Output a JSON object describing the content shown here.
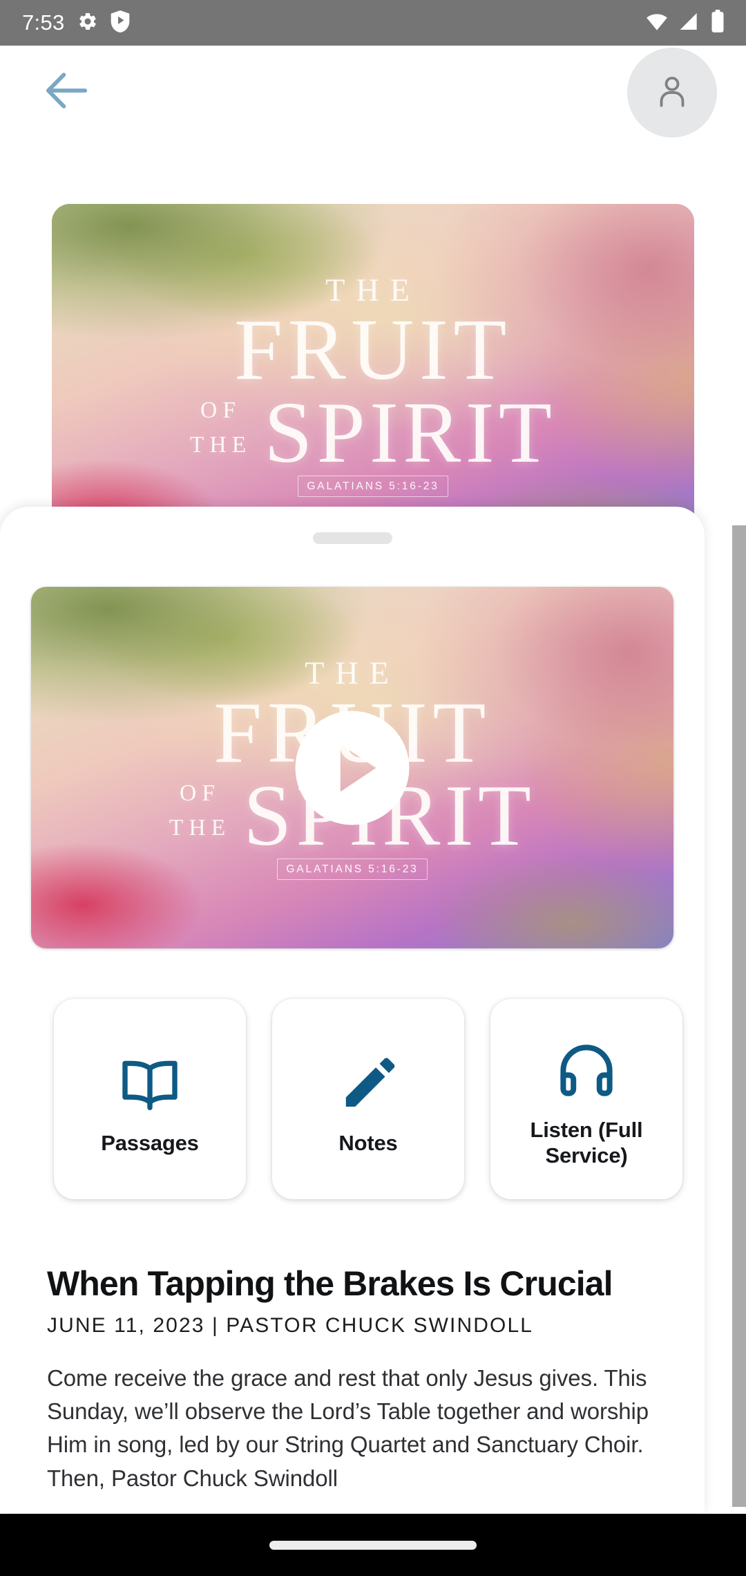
{
  "status_bar": {
    "time": "7:53",
    "left_icons": [
      "gear-icon",
      "play-protect-shield-icon"
    ],
    "right_icons": [
      "wifi-icon",
      "cellular-signal-icon",
      "battery-icon"
    ],
    "background_color": "#757575"
  },
  "app_bar": {
    "back_icon": "back-arrow-icon",
    "back_color": "#7ba7c4",
    "avatar_icon": "person-icon",
    "avatar_bg": "#e6e7e8"
  },
  "artwork": {
    "line_the": "THE",
    "line_fruit": "FRUIT",
    "line_of": "OF",
    "line_the2": "THE",
    "line_spirit": "SPIRIT",
    "reference": "GALATIANS 5:16-23"
  },
  "sheet": {
    "handle": "drag-handle",
    "video": {
      "play_icon": "play-icon",
      "label": "Sermon video thumbnail"
    },
    "actions": [
      {
        "label": "Passages",
        "icon": "open-book-icon"
      },
      {
        "label": "Notes",
        "icon": "pencil-icon"
      },
      {
        "label": "Listen (Full Service)",
        "icon": "headphones-icon"
      }
    ],
    "accent_color": "#0e5a85",
    "sermon": {
      "title": "When Tapping the Brakes Is Crucial",
      "byline": "JUNE 11, 2023 | PASTOR CHUCK SWINDOLL",
      "body": "Come receive the grace and rest that only Jesus gives. This Sunday, we’ll observe the Lord’s Table together and worship Him in song, led by our String Quartet and Sanctuary Choir. Then, Pastor Chuck Swindoll"
    }
  },
  "nav_bar": {
    "gesture_pill": "home-gesture-pill",
    "background_color": "#000000"
  }
}
